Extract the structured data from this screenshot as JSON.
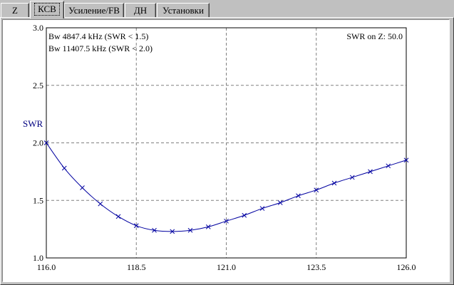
{
  "tabs": [
    {
      "label": "Z",
      "active": false
    },
    {
      "label": "КСВ",
      "active": true
    },
    {
      "label": "Усиление/FB",
      "active": false
    },
    {
      "label": "ДН",
      "active": false
    },
    {
      "label": "Установки",
      "active": false
    }
  ],
  "info": {
    "bw1": "Bw 4847.4 kHz (SWR < 1.5)",
    "bw2": "Bw 11407.5 kHz (SWR < 2.0)",
    "swr_on_z": "SWR on Z: 50.0"
  },
  "colors": {
    "curve": "#0000a0",
    "label": "#000080",
    "grid": "#808080"
  },
  "chart_data": {
    "type": "line",
    "title": "",
    "xlabel": "",
    "ylabel": "SWR",
    "xlim": [
      116.0,
      126.0
    ],
    "ylim": [
      1.0,
      3.0
    ],
    "x_ticks": [
      "116.0",
      "118.5",
      "121.0",
      "123.5",
      "126.0"
    ],
    "y_ticks": [
      "1.0",
      "1.5",
      "2.0",
      "2.5",
      "3.0"
    ],
    "x_tick_values": [
      116.0,
      118.5,
      121.0,
      123.5,
      126.0
    ],
    "y_tick_values": [
      1.0,
      1.5,
      2.0,
      2.5,
      3.0
    ],
    "grid": true,
    "series": [
      {
        "x": [
          116.0,
          116.5,
          117.0,
          117.5,
          118.0,
          118.5,
          119.0,
          119.5,
          120.0,
          120.5,
          121.0,
          121.5,
          122.0,
          122.5,
          123.0,
          123.5,
          124.0,
          124.5,
          125.0,
          125.5,
          126.0
        ],
        "values": [
          2.0,
          1.78,
          1.61,
          1.47,
          1.36,
          1.28,
          1.24,
          1.23,
          1.24,
          1.27,
          1.32,
          1.37,
          1.43,
          1.48,
          1.54,
          1.59,
          1.65,
          1.7,
          1.75,
          1.8,
          1.85
        ]
      }
    ]
  }
}
